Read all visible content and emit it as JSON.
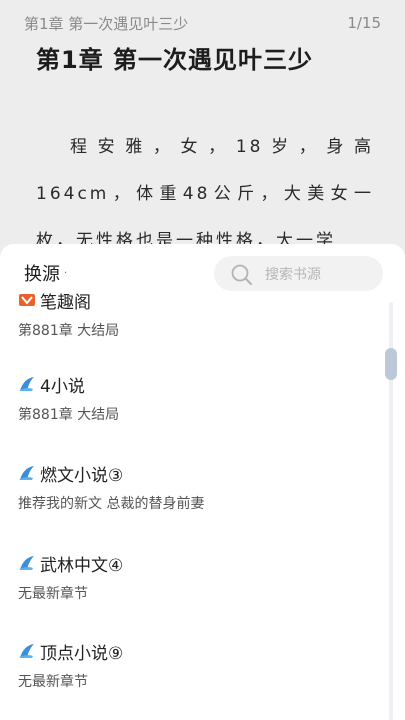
{
  "reader": {
    "header_chapter": "第1章 第一次遇见叶三少",
    "page_indicator": "1/15",
    "chapter_title": "第1章 第一次遇见叶三少",
    "body_text": "程安雅，女，18岁，身高164cm，体重48公斤，大美女一枚，无性格也是一种性格，大一学"
  },
  "sheet": {
    "title": "换源",
    "title_dot": "·",
    "search_placeholder": "搜索书源",
    "sources": [
      {
        "name": "笔趣阁",
        "latest": "第881章 大结局",
        "logo": "biquge-logo-icon"
      },
      {
        "name": "4小说",
        "latest": "第881章 大结局",
        "logo": "source-logo-icon"
      },
      {
        "name": "燃文小说③",
        "latest": "推荐我的新文 总裁的替身前妻",
        "logo": "source-logo-icon"
      },
      {
        "name": "武林中文④",
        "latest": "无最新章节",
        "logo": "source-logo-icon"
      },
      {
        "name": "顶点小说⑨",
        "latest": "无最新章节",
        "logo": "source-logo-icon"
      }
    ]
  },
  "colors": {
    "reader_bg": "#ededed",
    "sheet_bg": "#ffffff",
    "logo_blue": "#3b8fd8",
    "logo_orange": "#e8622b",
    "scroll_thumb": "#bcc9da"
  }
}
